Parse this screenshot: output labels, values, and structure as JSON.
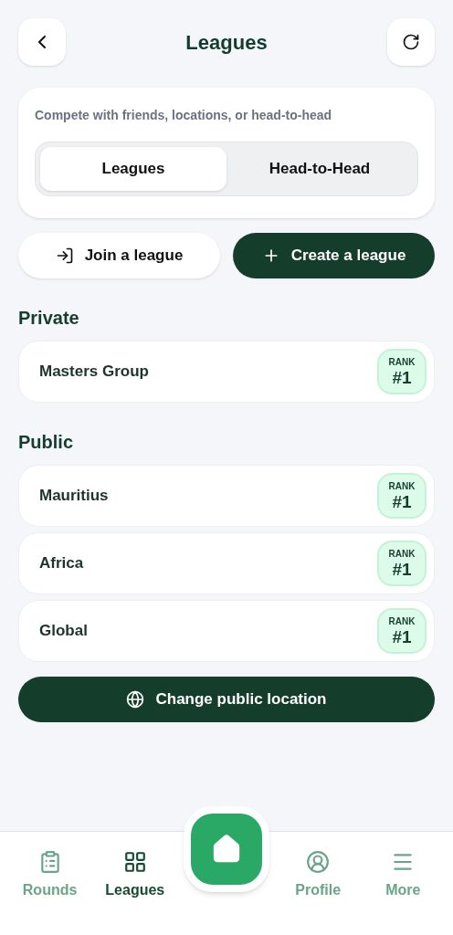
{
  "header": {
    "title": "Leagues"
  },
  "intro": {
    "subtitle": "Compete with friends, locations, or head-to-head",
    "tabs": [
      {
        "label": "Leagues",
        "selected": true
      },
      {
        "label": "Head-to-Head",
        "selected": false
      }
    ]
  },
  "actions": [
    {
      "kind": "join",
      "label": "Join a league"
    },
    {
      "kind": "create",
      "label": "Create a league"
    }
  ],
  "sections": [
    {
      "heading": "Private",
      "leagues": [
        {
          "name": "Masters Group",
          "rank_label": "RANK",
          "rank": "#1"
        }
      ]
    },
    {
      "heading": "Public",
      "leagues": [
        {
          "name": "Mauritius",
          "rank_label": "RANK",
          "rank": "#1"
        },
        {
          "name": "Africa",
          "rank_label": "RANK",
          "rank": "#1"
        },
        {
          "name": "Global",
          "rank_label": "RANK",
          "rank": "#1"
        }
      ]
    }
  ],
  "location_button": {
    "label": "Change public location"
  },
  "bottom_nav": [
    {
      "kind": "rounds",
      "label": "Rounds",
      "selected": false
    },
    {
      "kind": "leagues",
      "label": "Leagues",
      "selected": true
    },
    {
      "kind": "home",
      "selected": false
    },
    {
      "kind": "profile",
      "label": "Profile",
      "selected": false
    },
    {
      "kind": "more",
      "label": "More",
      "selected": false
    }
  ]
}
